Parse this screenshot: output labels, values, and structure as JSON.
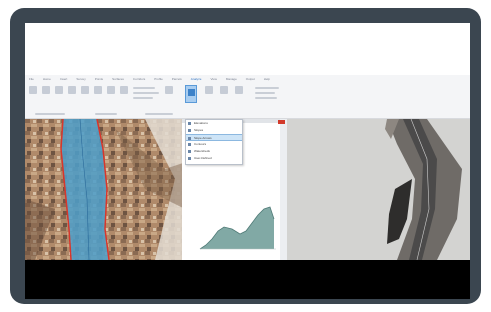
{
  "ribbon": {
    "tabs": [
      "File",
      "Home",
      "Insert",
      "Survey",
      "Points",
      "Surfaces",
      "Corridors",
      "Profile",
      "Parcels",
      "Analyze",
      "View",
      "Manage",
      "Output",
      "Help"
    ],
    "active_tab": "Analyze"
  },
  "dropdown": {
    "items": [
      "Elevations",
      "Slopes",
      "Slope Arrows",
      "Contours",
      "Watersheds",
      "User-Defined"
    ],
    "highlighted_index": 2
  },
  "colors": {
    "frame": "#3b4650",
    "corridor_fill": "#4f9dc7",
    "corridor_outline": "#d8362b",
    "profile_fill": "#6b9a95",
    "accent": "#2b6fbf"
  },
  "icons": {
    "close": "close-icon",
    "ribbon_command": "ribbon-command-icon"
  }
}
